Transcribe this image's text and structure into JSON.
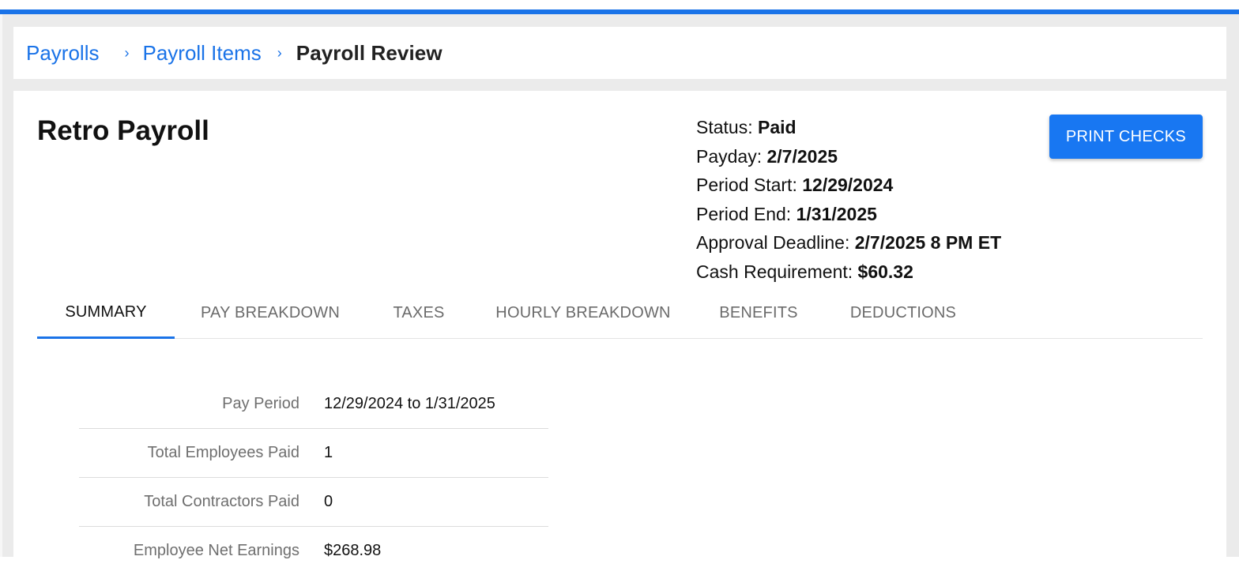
{
  "breadcrumb": {
    "items": [
      "Payrolls",
      "Payroll Items"
    ],
    "separator": "›",
    "current": "Payroll Review"
  },
  "page": {
    "title": "Retro Payroll"
  },
  "meta": {
    "status_label": "Status:",
    "status_value": "Paid",
    "payday_label": "Payday:",
    "payday_value": "2/7/2025",
    "period_start_label": "Period Start:",
    "period_start_value": "12/29/2024",
    "period_end_label": "Period End:",
    "period_end_value": "1/31/2025",
    "approval_deadline_label": "Approval Deadline:",
    "approval_deadline_value": "2/7/2025 8 PM ET",
    "cash_requirement_label": "Cash Requirement:",
    "cash_requirement_value": "$60.32"
  },
  "actions": {
    "print_checks_label": "PRINT CHECKS"
  },
  "tabs": [
    {
      "label": "SUMMARY",
      "active": true
    },
    {
      "label": "PAY BREAKDOWN",
      "active": false
    },
    {
      "label": "TAXES",
      "active": false
    },
    {
      "label": "HOURLY BREAKDOWN",
      "active": false
    },
    {
      "label": "BENEFITS",
      "active": false
    },
    {
      "label": "DEDUCTIONS",
      "active": false
    }
  ],
  "summary": {
    "rows": [
      {
        "label": "Pay Period",
        "value": "12/29/2024 to 1/31/2025"
      },
      {
        "label": "Total Employees Paid",
        "value": "1"
      },
      {
        "label": "Total Contractors Paid",
        "value": "0"
      },
      {
        "label": "Employee Net Earnings",
        "value": "$268.98"
      }
    ]
  },
  "colors": {
    "accent": "#1a73e8",
    "button": "#1877f2",
    "background": "#ebebeb"
  }
}
